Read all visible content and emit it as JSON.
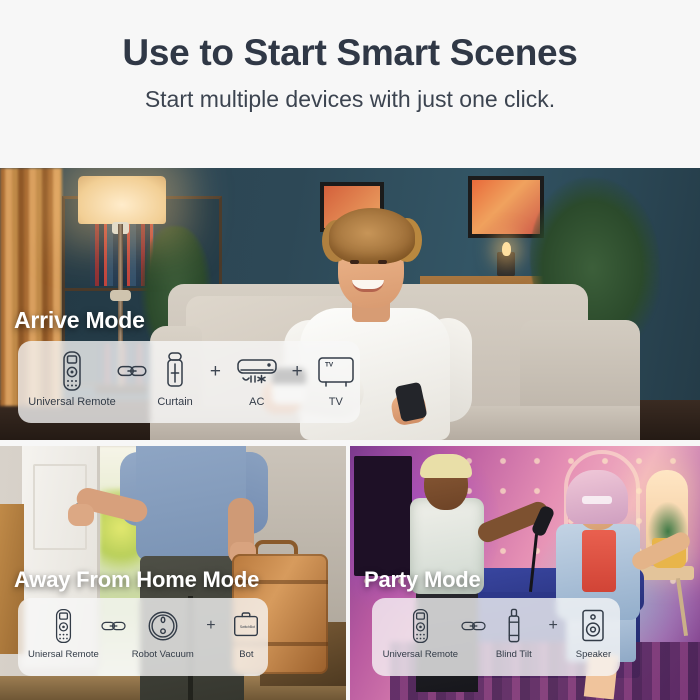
{
  "header": {
    "headline": "Use to Start Smart Scenes",
    "subhead": "Start multiple devices with just one click.",
    "headline_color": "#303846",
    "background": "#f7f7f7"
  },
  "scenes": [
    {
      "id": "arrive",
      "label": "Arrive Mode",
      "position": "hero",
      "photo_description": "Young man with curly hair sitting on a light grey sofa in a dark teal living room, pointing a white remote at the camera, lit floor lamp and potted plant behind him",
      "chips": [
        {
          "name": "Universal Remote",
          "icon": "universal-remote-icon"
        },
        {
          "name": "",
          "icon": "link-icon",
          "joiner": true
        },
        {
          "name": "Curtain",
          "icon": "curtain-icon"
        },
        {
          "name": "",
          "icon": "plus-icon",
          "joiner": true,
          "symbol": "+"
        },
        {
          "name": "AC",
          "icon": "air-conditioner-icon"
        },
        {
          "name": "",
          "icon": "plus-icon",
          "joiner": true,
          "symbol": "+"
        },
        {
          "name": "TV",
          "icon": "tv-icon"
        }
      ]
    },
    {
      "id": "away-from-home",
      "label": "Away From Home Mode",
      "position": "bottom-left",
      "photo_description": "Man in a blue t-shirt opening a white front door while carrying a brown suitcase, wooden cabinet at left and greenery outside",
      "chips": [
        {
          "name": "Uniersal Remote",
          "icon": "universal-remote-icon"
        },
        {
          "name": "",
          "icon": "link-icon",
          "joiner": true
        },
        {
          "name": "Robot Vacuum",
          "icon": "robot-vacuum-icon"
        },
        {
          "name": "",
          "icon": "plus-icon",
          "joiner": true,
          "symbol": "+"
        },
        {
          "name": "Bot",
          "icon": "bot-icon"
        }
      ]
    },
    {
      "id": "party",
      "label": "Party Mode",
      "position": "bottom-right",
      "photo_description": "Two people singing karaoke with a microphone in a living room washed in pink and purple party lighting, blue sofa and patterned rug",
      "chips": [
        {
          "name": "Universal Remote",
          "icon": "universal-remote-icon"
        },
        {
          "name": "",
          "icon": "link-icon",
          "joiner": true
        },
        {
          "name": "Blind Tilt",
          "icon": "blind-tilt-icon"
        },
        {
          "name": "",
          "icon": "plus-icon",
          "joiner": true,
          "symbol": "+"
        },
        {
          "name": "Speaker",
          "icon": "speaker-icon"
        }
      ]
    }
  ],
  "bot_icon_text": "SwitchBot",
  "tv_icon_text": "TV",
  "colors": {
    "text_dark": "#333c48",
    "heading": "#303846",
    "panel_fill": "rgba(247,247,247,0.78)",
    "label_text": "#ffffff"
  }
}
